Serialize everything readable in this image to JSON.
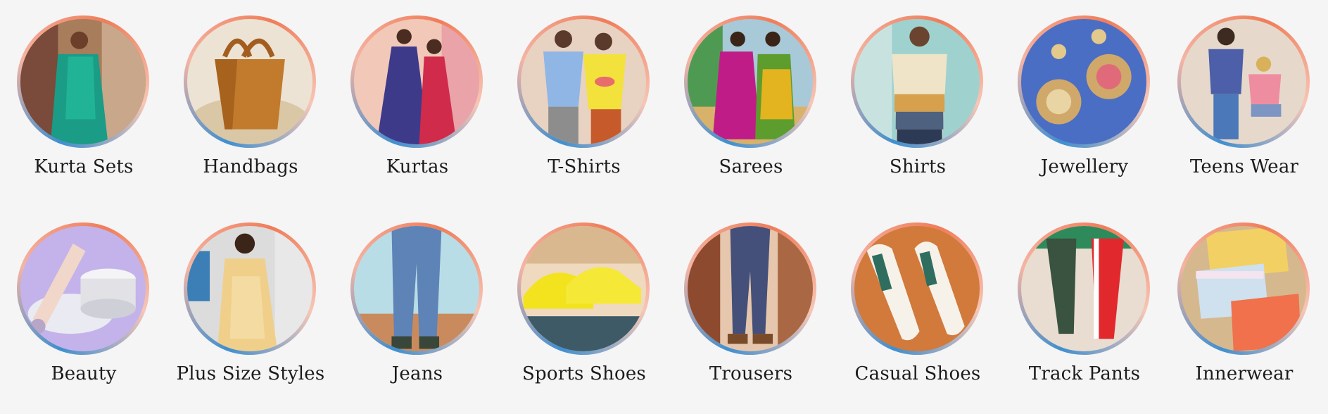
{
  "categories": [
    {
      "label": "Kurta Sets",
      "image": "woman-green-kurta-set"
    },
    {
      "label": "Handbags",
      "image": "tan-leather-handbag"
    },
    {
      "label": "Kurtas",
      "image": "two-women-in-kurtas"
    },
    {
      "label": "T-Shirts",
      "image": "two-men-in-t-shirts"
    },
    {
      "label": "Sarees",
      "image": "two-women-in-sarees"
    },
    {
      "label": "Shirts",
      "image": "man-in-ombre-shirt"
    },
    {
      "label": "Jewellery",
      "image": "pair-of-earrings"
    },
    {
      "label": "Teens Wear",
      "image": "two-teens"
    },
    {
      "label": "Beauty",
      "image": "cosmetic-tube-and-jar"
    },
    {
      "label": "Plus Size Styles",
      "image": "woman-in-yellow-dress"
    },
    {
      "label": "Jeans",
      "image": "man-in-blue-jeans"
    },
    {
      "label": "Sports Shoes",
      "image": "yellow-sneakers"
    },
    {
      "label": "Trousers",
      "image": "checked-trousers"
    },
    {
      "label": "Casual Shoes",
      "image": "white-embroidered-sneakers"
    },
    {
      "label": "Track Pants",
      "image": "track-pants-legs"
    },
    {
      "label": "Innerwear",
      "image": "innerwear-trunks"
    }
  ]
}
